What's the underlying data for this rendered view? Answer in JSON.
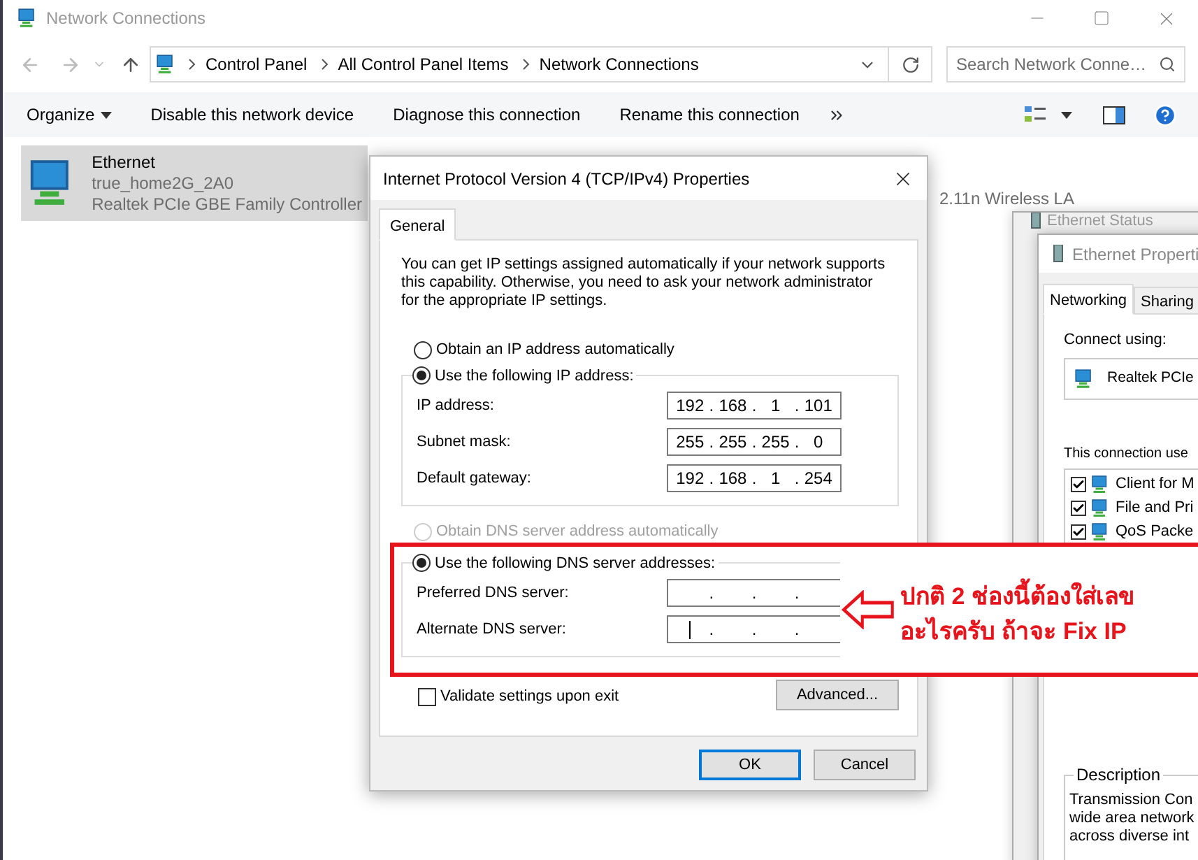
{
  "window": {
    "title": "Network Connections"
  },
  "address_bar": {
    "path": [
      "Control Panel",
      "All Control Panel Items",
      "Network Connections"
    ]
  },
  "search": {
    "placeholder": "Search Network Conne…"
  },
  "toolbar": {
    "items": [
      "Organize",
      "Disable this network device",
      "Diagnose this connection",
      "Rename this connection"
    ]
  },
  "connections": [
    {
      "name": "Ethernet",
      "network": "true_home2G_2A0",
      "adapter": "Realtek PCIe GBE Family Controller",
      "selected": true
    }
  ],
  "partial_adapter": "2.11n Wireless LA",
  "status_window": {
    "title": "Ethernet Status"
  },
  "properties_window": {
    "title": "Ethernet Properti",
    "tabs": [
      {
        "label": "Networking",
        "selected": true
      },
      {
        "label": "Sharing",
        "selected": false
      }
    ],
    "connect_using_label": "Connect using:",
    "adapter": "Realtek PCIe",
    "items_label": "This connection use",
    "items": [
      {
        "label": "Client for M",
        "checked": true
      },
      {
        "label": "File and Pri",
        "checked": true
      },
      {
        "label": "QoS Packe",
        "checked": true
      }
    ],
    "description": {
      "title": "Description",
      "lines": [
        "Transmission Con",
        "wide area network",
        "across diverse int"
      ]
    }
  },
  "dialog": {
    "title": "Internet Protocol Version 4 (TCP/IPv4) Properties",
    "tabs": [
      {
        "label": "General",
        "selected": true
      }
    ],
    "intro": "You can get IP settings assigned automatically if your network supports this capability. Otherwise, you need to ask your network administrator for the appropriate IP settings.",
    "ip_options": [
      {
        "label": "Obtain an IP address automatically",
        "selected": false,
        "disabled": false
      },
      {
        "label": "Use the following IP address:",
        "selected": true,
        "disabled": false
      }
    ],
    "ip_fields": [
      {
        "label": "IP address:",
        "octets": [
          "192",
          "168",
          "1",
          "101"
        ],
        "focused": false
      },
      {
        "label": "Subnet mask:",
        "octets": [
          "255",
          "255",
          "255",
          "0"
        ],
        "focused": false
      },
      {
        "label": "Default gateway:",
        "octets": [
          "192",
          "168",
          "1",
          "254"
        ],
        "focused": false
      }
    ],
    "dns_options": [
      {
        "label": "Obtain DNS server address automatically",
        "selected": false,
        "disabled": true
      },
      {
        "label": "Use the following DNS server addresses:",
        "selected": true,
        "disabled": false
      }
    ],
    "dns_fields": [
      {
        "label": "Preferred DNS server:",
        "focused": false
      },
      {
        "label": "Alternate DNS server:",
        "focused": true
      }
    ],
    "separator": ".",
    "validate": {
      "label": "Validate settings upon exit",
      "checked": false
    },
    "advanced_button": "Advanced...",
    "buttons": [
      {
        "label": "OK",
        "default": true
      },
      {
        "label": "Cancel",
        "default": false
      }
    ]
  },
  "annotation": {
    "lines": [
      "ปกติ 2 ช่องนี้ต้องใส่เลข",
      "อะไรครับ ถ้าจะ Fix IP"
    ]
  }
}
